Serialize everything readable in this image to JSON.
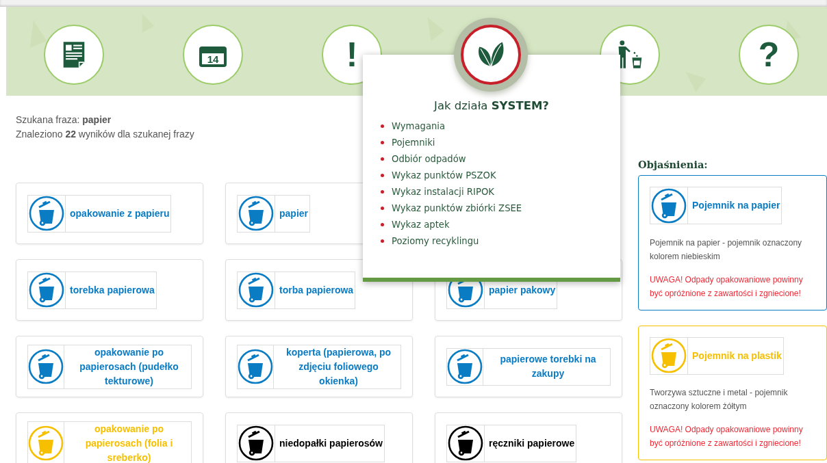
{
  "nav": [
    {
      "kind": "document",
      "selected": false
    },
    {
      "kind": "calendar",
      "label": "14",
      "selected": false
    },
    {
      "kind": "glyph",
      "label": "!",
      "selected": false
    },
    {
      "kind": "leaf",
      "selected": true
    },
    {
      "kind": "bin-person",
      "selected": false
    },
    {
      "kind": "glyph",
      "label": "?",
      "selected": false
    }
  ],
  "popup": {
    "title": "Jak działa **SYSTEM?**",
    "links": [
      "Wymagania",
      "Pojemniki",
      "Odbiór odpadów",
      "Wykaz punktów PSZOK",
      "Wykaz instalacji RIPOK",
      "Wykaz punktów zbiórki ZSEE",
      "Wykaz aptek",
      "Poziomy recyklingu"
    ]
  },
  "search": {
    "phrase": "Szukana fraza: **papier**",
    "found": "Znaleziono **22** wyników dla szukanej frazy"
  },
  "results": [
    [
      {
        "label": "opakowanie z papieru",
        "color": "#0a7cc4"
      },
      {
        "label": "papier",
        "color": "#0a7cc4"
      }
    ],
    [
      {
        "label": "torebka papierowa",
        "color": "#0a7cc4"
      },
      {
        "label": "torba papierowa",
        "color": "#0a7cc4"
      },
      {
        "label": "papier pakowy",
        "color": "#0a7cc4"
      }
    ],
    [
      {
        "label": "opakowanie po papierosach (pudełko tekturowe)",
        "color": "#0a7cc4"
      },
      {
        "label": "koperta (papierowa, po zdjęciu foliowego okienka)",
        "color": "#0a7cc4"
      },
      {
        "label": "papierowe torebki na zakupy",
        "color": "#0a7cc4"
      }
    ],
    [
      {
        "label": "opakowanie po papierosach (folia i sreberko)",
        "color": "#f6c000"
      },
      {
        "label": "niedopałki papierosów",
        "color": "#000000"
      },
      {
        "label": "ręczniki papierowe",
        "color": "#000000"
      }
    ]
  ],
  "legend": {
    "heading": "Objaśnienia:",
    "items": [
      {
        "label": "Pojemnik na papier",
        "color": "#0a7cc4",
        "description": "Pojemnik na papier - pojemnik oznaczony kolorem niebieskim",
        "warning": "UWAGA! Odpady opakowaniowe powinny być opróżnione z zawartości i zgniecione!"
      },
      {
        "label": "Pojemnik na plastik",
        "color": "#f6c000",
        "description": "Tworzywa sztuczne i metal - pojemnik oznaczony kolorem żółtym",
        "warning": "UWAGA! Odpady opakowaniowe powinny być opróżnione z zawartości i zgniecione!"
      }
    ]
  }
}
